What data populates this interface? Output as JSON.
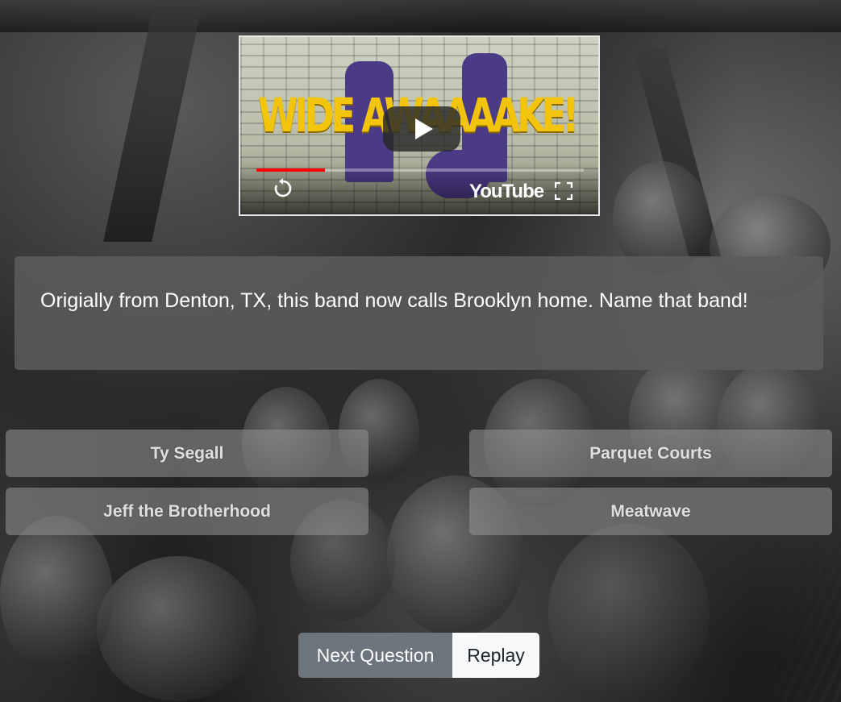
{
  "video": {
    "thumbnail_title": "WIDE AWAAAAKE!",
    "brand_label": "YouTube",
    "progress_fraction": 0.21,
    "accent_color": "#ff0000",
    "play_icon": "play-icon",
    "replay_icon": "replay-icon",
    "fullscreen_icon": "fullscreen-icon"
  },
  "question": {
    "text": "Origially from Denton, TX, this band now calls Brooklyn home. Name that band!"
  },
  "answers": [
    {
      "label": "Ty Segall"
    },
    {
      "label": "Parquet Courts"
    },
    {
      "label": "Jeff the Brotherhood"
    },
    {
      "label": "Meatwave"
    }
  ],
  "actions": {
    "next_label": "Next Question",
    "replay_label": "Replay"
  }
}
